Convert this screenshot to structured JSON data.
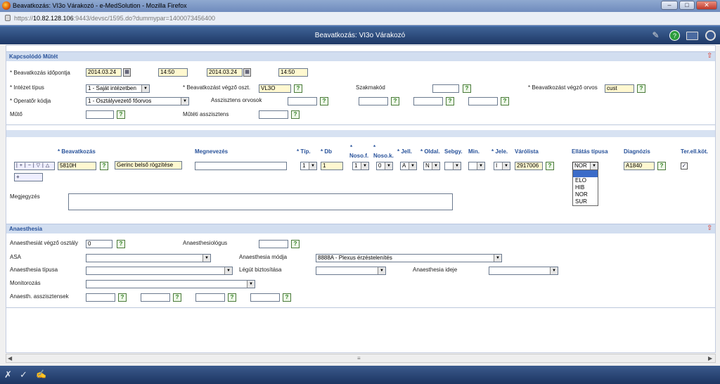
{
  "window": {
    "title": "Beavatkozás: VI3o Várakozó - e-MedSolution - Mozilla Firefox",
    "minimize": "–",
    "maximize": "□",
    "close": "✕"
  },
  "url": {
    "host": "https://",
    "domain": "10.82.128.106",
    "rest": ":9443/devsc/1595.do?dummypar=1400073456400"
  },
  "app": {
    "title": "Beavatkozás: VI3o Várakozó"
  },
  "kapcs": {
    "header": "Kapcsolódó Műtét",
    "idopont_label": "* Beavatkozás időpontja",
    "date1": "2014.03.24",
    "time1": "14:50",
    "date2": "2014.03.24",
    "time2": "14:50",
    "intezet_label": "* Intézet típus",
    "intezet_value": "1 - Saját intézetben",
    "oszt_label": "* Beavatkozást végző oszt.",
    "oszt_value": "VL3O",
    "szakmakod_label": "Szakmakód",
    "orvos_label": "* Beavatkozást végző orvos",
    "orvos_value": "cust",
    "operator_label": "* Operatőr kódja",
    "operator_value": "1 - Osztályvezető főorvos",
    "asszisztens_label": "Asszisztens orvosok",
    "muto_label": "Műtő",
    "mutoasszisztens_label": "Műtéti asszisztens"
  },
  "proc": {
    "headers": {
      "beavatkozas": "* Beavatkozás",
      "megnevezes": "Megnevezés",
      "tip": "* Típ.",
      "db": "* Db",
      "nosof": "Noso.f.",
      "nosok": "Noso.k.",
      "nosof_star": "*",
      "nosok_star": "*",
      "jell": "* Jell.",
      "oldal": "* Oldal.",
      "sebgy": "Sebgy.",
      "min": "Min.",
      "jele": "* Jele.",
      "varolista": "Várólista",
      "ellatas": "Ellátás típusa",
      "diagnozis": "Diagnózis",
      "terell": "Ter.ell.köt."
    },
    "row": {
      "code": "5810H",
      "name": "Gerinc belső rögzítése",
      "tip": "1",
      "db": "1",
      "nosof": "1",
      "nosok": "0",
      "jell": "A",
      "oldal": "N",
      "jele": "I",
      "varolista": "2917006",
      "ellatas": "NOR",
      "diagnozis": "A1840"
    },
    "dropdown": [
      "",
      "ELO",
      "HIB",
      "NOR",
      "SUR"
    ],
    "megjegyzes_label": "Megjegyzés"
  },
  "anaest": {
    "header": "Anaesthesia",
    "osztaly_label": "Anaesthesiát végző osztály",
    "osztaly_value": "0",
    "anaesthesiologus_label": "Anaesthesiológus",
    "asa_label": "ASA",
    "modja_label": "Anaesthesia módja",
    "modja_value": "8888A - Plexus érzéstelenítés",
    "tipus_label": "Anaesthesia típusa",
    "legut_label": "Légút biztosítása",
    "ideje_label": "Anaesthesia ideje",
    "monitor_label": "Monitorozás",
    "asszisztensek_label": "Anaesth. asszisztensek"
  },
  "icons": {
    "q": "?",
    "cal": "▦",
    "arrow": "▼",
    "up": "⇧"
  }
}
